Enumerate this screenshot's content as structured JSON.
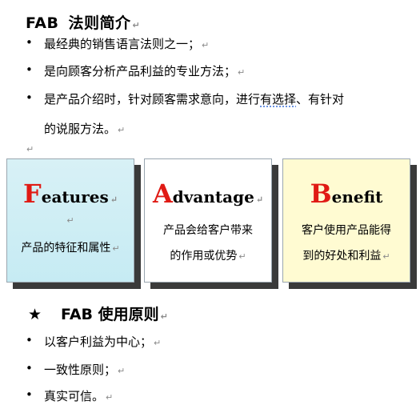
{
  "heading1": {
    "latin": "FAB",
    "cjk": "法则简介"
  },
  "para_mark": "↵",
  "section1_bullets": [
    {
      "text": "最经典的销售语言法则之一；"
    },
    {
      "text": "是向顾客分析产品利益的专业方法；"
    },
    {
      "text_before": "是产品介绍时，针对顾客需求意向，进行",
      "text_underlined": "有选择",
      "text_after": "、有针对"
    }
  ],
  "section1_continuation": "的说服方法。",
  "cards": [
    {
      "initial": "F",
      "rest": "eatures",
      "lines": [
        "产品的特征和属性"
      ],
      "bg": "#cdeef5"
    },
    {
      "initial": "A",
      "rest": "dvantage",
      "lines": [
        "产品会给客户带来",
        "的作用或优势"
      ],
      "bg": "#ffffff"
    },
    {
      "initial": "B",
      "rest": "enefit",
      "lines": [
        "客户使用产品能得",
        "到的好处和利益"
      ],
      "bg": "#fffbd2"
    }
  ],
  "heading2": {
    "star": "★",
    "text": "FAB 使用原则"
  },
  "section2_bullets": [
    {
      "text": "以客户利益为中心；"
    },
    {
      "text": "一致性原则；"
    },
    {
      "text": "真实可信。"
    }
  ],
  "colors": {
    "accent_initial": "#e01a14",
    "shadow": "#3a3a3a"
  }
}
